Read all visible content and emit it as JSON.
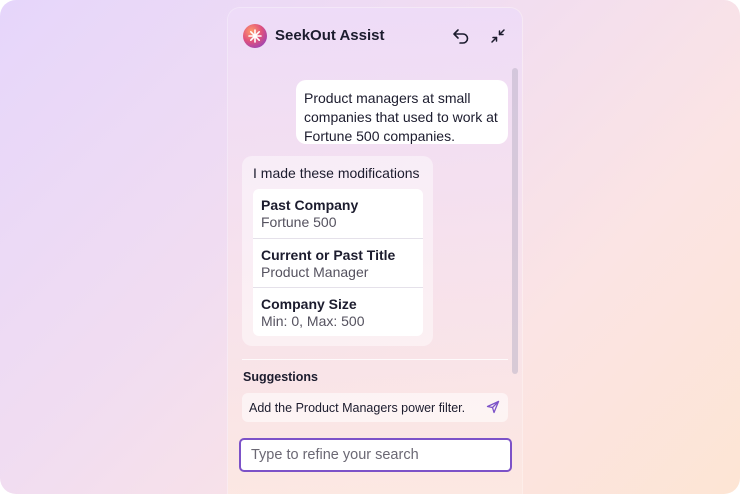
{
  "header": {
    "title": "SeekOut Assist",
    "logo_icon": "sparkle-icon",
    "actions": [
      {
        "name": "undo",
        "icon": "undo-icon"
      },
      {
        "name": "collapse",
        "icon": "collapse-arrows-icon"
      }
    ]
  },
  "conversation": {
    "user_message": "Product managers at small companies that used to work at Fortune 500 companies.",
    "assistant_intro": "I made these modifications",
    "modifications": [
      {
        "title": "Past Company",
        "value": "Fortune 500"
      },
      {
        "title": "Current or Past Title",
        "value": "Product Manager"
      },
      {
        "title": "Company Size",
        "value": "Min: 0, Max: 500"
      }
    ]
  },
  "suggestions": {
    "heading": "Suggestions",
    "items": [
      {
        "label": "Add the Product Managers power filter.",
        "icon": "send-icon"
      }
    ]
  },
  "input": {
    "placeholder": "Type to refine your search",
    "value": ""
  },
  "colors": {
    "accent": "#7c52c8",
    "text": "#1c1c2e",
    "secondary_text": "#55525f"
  }
}
